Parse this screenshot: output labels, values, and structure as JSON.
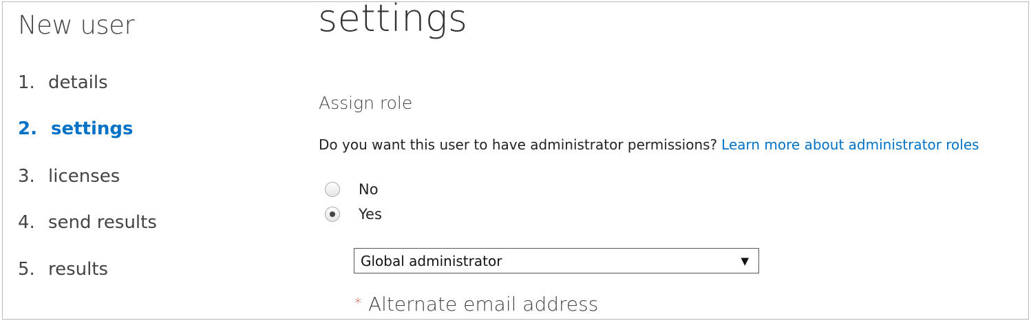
{
  "wizard": {
    "title": "New user",
    "steps": [
      {
        "number": "1.",
        "label": "details"
      },
      {
        "number": "2.",
        "label": "settings",
        "active": true
      },
      {
        "number": "3.",
        "label": "licenses"
      },
      {
        "number": "4.",
        "label": "send results"
      },
      {
        "number": "5.",
        "label": "results"
      }
    ]
  },
  "main": {
    "page_title": "settings",
    "section_heading": "Assign role",
    "question": "Do you want this user to have administrator permissions?",
    "learn_more_link": "Learn more about administrator roles",
    "radio_options": [
      {
        "label": "No",
        "checked": false
      },
      {
        "label": "Yes",
        "checked": true
      }
    ],
    "role_select": {
      "selected": "Global administrator",
      "arrow": "▼"
    },
    "alternate_email": {
      "required_marker": "*",
      "label": "Alternate email address"
    }
  },
  "colors": {
    "accent": "#0072c6",
    "required": "#c0392b"
  }
}
